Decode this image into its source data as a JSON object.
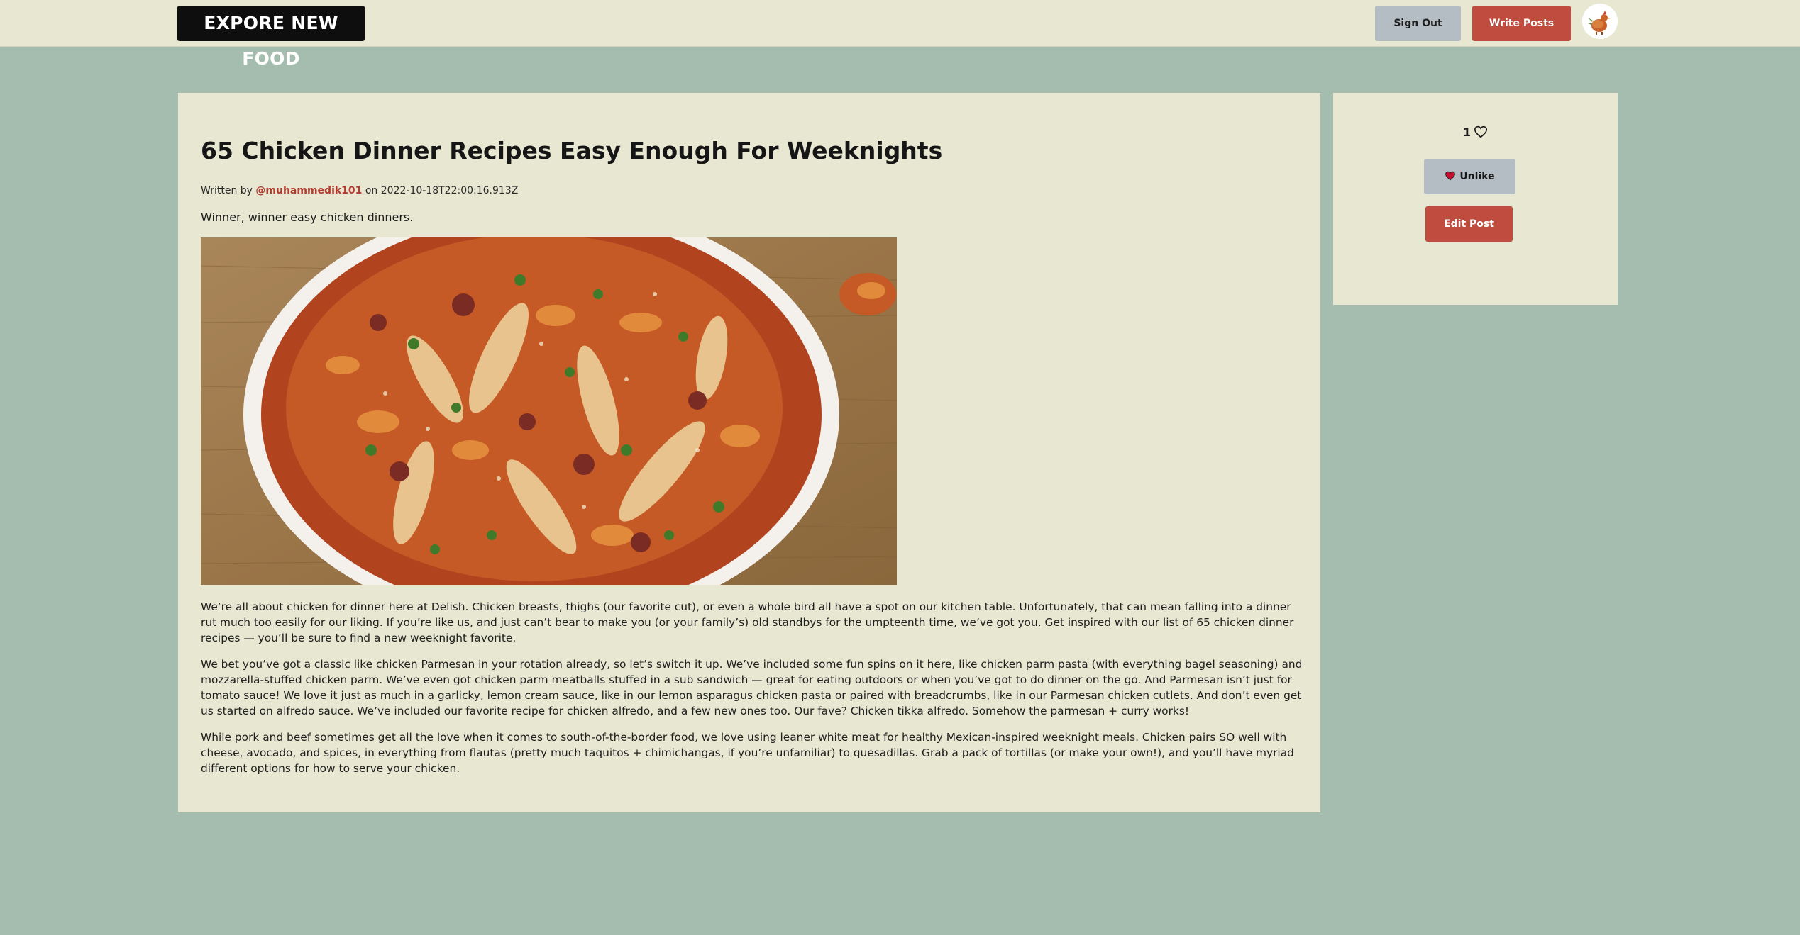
{
  "navbar": {
    "brand": "EXPORE NEW FOOD",
    "sign_out_label": "Sign Out",
    "write_posts_label": "Write Posts",
    "avatar_icon": "chicken-avatar-icon"
  },
  "article": {
    "title": "65 Chicken Dinner Recipes Easy Enough For Weeknights",
    "byline_prefix": "Written by",
    "author": "@muhammedik101",
    "byline_on": "on",
    "date": "2022-10-18T22:00:16.913Z",
    "summary": "Winner, winner easy chicken dinners.",
    "paragraphs": [
      "We’re all about chicken for dinner here at Delish. Chicken breasts, thighs (our favorite cut), or even a whole bird all have a spot on our kitchen table. Unfortunately, that can mean falling into a dinner rut much too easily for our liking. If you’re like us, and just can’t bear to make you (or your family’s) old standbys for the umpteenth time, we’ve got you. Get inspired with our list of 65 chicken dinner recipes — you’ll be sure to find a new weeknight favorite.",
      "We bet you’ve got a classic like chicken Parmesan in your rotation already, so let’s switch it up. We’ve included some fun spins on it here, like chicken parm pasta (with everything bagel seasoning) and mozzarella-stuffed chicken parm. We’ve even got chicken parm meatballs stuffed in a sub sandwich — great for eating outdoors or when you’ve got to do dinner on the go. And Parmesan isn’t just for tomato sauce! We love it just as much in a garlicky, lemon cream sauce, like in our lemon asparagus chicken pasta or paired with breadcrumbs, like in our Parmesan chicken cutlets. And don’t even get us started on alfredo sauce. We’ve included our favorite recipe for chicken alfredo, and a few new ones too. Our fave? Chicken tikka alfredo. Somehow the parmesan + curry works!",
      "While pork and beef sometimes get all the love when it comes to south-of-the-border food, we love using leaner white meat for healthy Mexican-inspired weeknight meals. Chicken pairs SO well with cheese, avocado, and spices, in everything from flautas (pretty much taquitos + chimichangas, if you’re unfamiliar) to quesadillas. Grab a pack of tortillas (or make your own!), and you’ll have myriad different options for how to serve your chicken."
    ]
  },
  "sidebar": {
    "like_count": "1",
    "unlike_label": "Unlike",
    "edit_label": "Edit Post"
  },
  "colors": {
    "page_bg": "#a5bdae",
    "card_bg": "#e7e7d2",
    "accent_red": "#c04c3f",
    "secondary_gray": "#b4bcc4",
    "brand_bg": "#0e0e0e"
  }
}
